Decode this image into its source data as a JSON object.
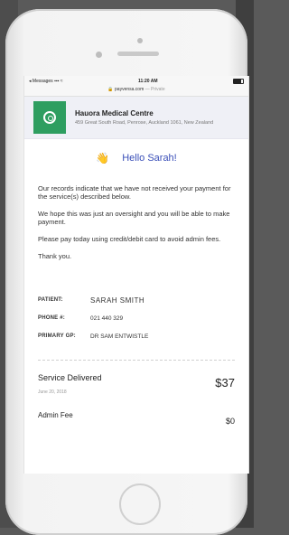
{
  "statusbar": {
    "back_app": "◂ Messages",
    "signal": "▪▪▪ ≈",
    "time": "11:20 AM",
    "battery": ""
  },
  "urlbar": {
    "lock": "🔒",
    "url": "payvensa.com",
    "private": "— Private"
  },
  "clinic": {
    "name": "Hauora Medical Centre",
    "address": "459 Great South Road, Penrose, Auckland 1061, New Zealand"
  },
  "message": {
    "wave_icon": "👋",
    "greeting": "Hello Sarah!",
    "paragraphs": [
      "Our records indicate that we have not received your payment for the service(s) described below.",
      "We hope this was just an oversight and you will be able to make payment.",
      "Please pay today using credit/debit card to avoid admin fees.",
      "Thank you."
    ]
  },
  "patient_info": {
    "patient_label": "PATIENT:",
    "patient_value": "SARAH SMITH",
    "phone_label": "PHONE #:",
    "phone_value": "021 440 329",
    "gp_label": "PRIMARY GP:",
    "gp_value": "DR SAM ENTWISTLE"
  },
  "services": {
    "service_title": "Service Delivered",
    "service_date": "June 20, 2018",
    "service_amount": "$37",
    "fee_title": "Admin Fee",
    "fee_amount": "$0"
  }
}
